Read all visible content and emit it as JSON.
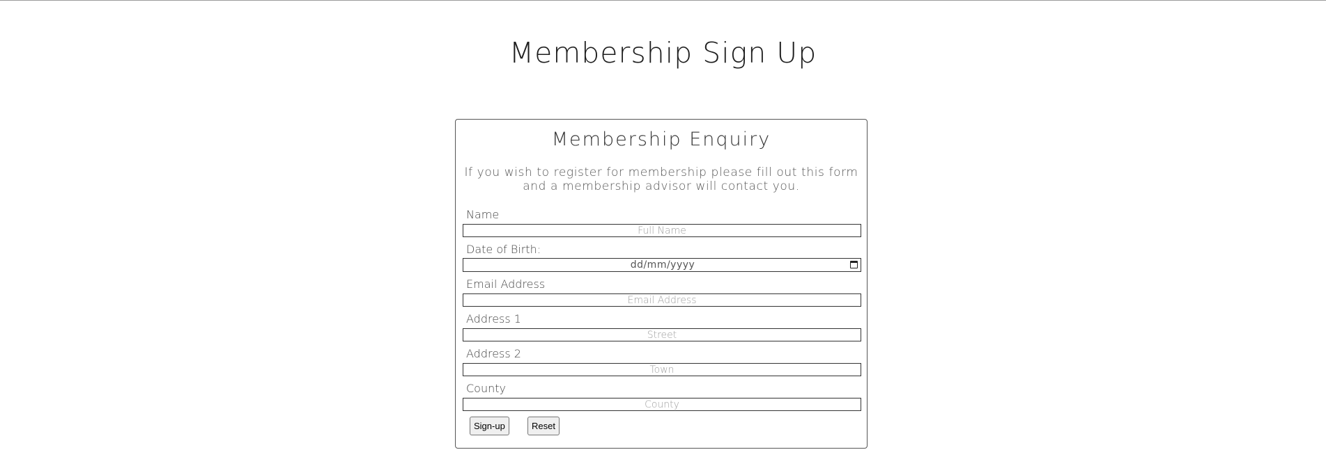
{
  "page": {
    "title": "Membership Sign Up"
  },
  "form": {
    "title": "Membership Enquiry",
    "intro": "If you wish to register for membership please fill out this form and a membership advisor will contact you.",
    "fields": {
      "name": {
        "label": "Name",
        "placeholder": "Full Name",
        "value": ""
      },
      "dob": {
        "label": "Date of Birth:",
        "display": "dd/mm/yyyy",
        "icon": "calendar-icon"
      },
      "email": {
        "label": "Email Address",
        "placeholder": "Email Address",
        "value": ""
      },
      "address1": {
        "label": "Address 1",
        "placeholder": "Street",
        "value": ""
      },
      "address2": {
        "label": "Address 2",
        "placeholder": "Town",
        "value": ""
      },
      "county": {
        "label": "County",
        "placeholder": "County",
        "value": ""
      }
    },
    "buttons": {
      "signup": "Sign-up",
      "reset": "Reset"
    }
  },
  "colors": {
    "text": "#222222",
    "border": "#333333",
    "placeholder": "#a0a0a0",
    "button_bg": "#efefef"
  }
}
